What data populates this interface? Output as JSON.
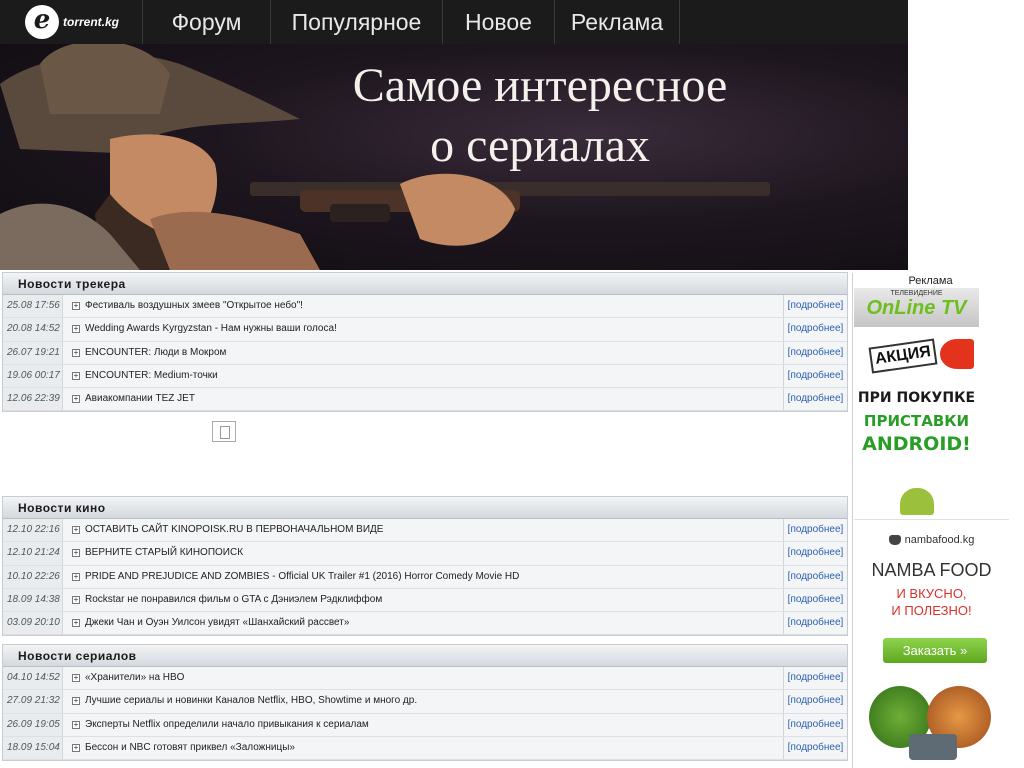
{
  "header": {
    "logo_text": "torrent.kg",
    "nav": [
      "Форум",
      "Популярное",
      "Новое",
      "Реклама"
    ]
  },
  "banner": {
    "line1": "Самое интересное",
    "line2": "о сериалах"
  },
  "sections": [
    {
      "title": "Новости трекера",
      "rows": [
        {
          "date": "25.08 17:56",
          "title": "Фестиваль воздушных змеев \"Открытое небо\"!",
          "more": "[подробнее]"
        },
        {
          "date": "20.08 14:52",
          "title": "Wedding Awards Kyrgyzstan - Нам нужны ваши голоса!",
          "more": "[подробнее]"
        },
        {
          "date": "26.07 19:21",
          "title": "ENCOUNTER: Люди в Мокром",
          "more": "[подробнее]"
        },
        {
          "date": "19.06 00:17",
          "title": "ENCOUNTER: Medium-точки",
          "more": "[подробнее]"
        },
        {
          "date": "12.06 22:39",
          "title": "Авиакомпании TEZ JET",
          "more": "[подробнее]"
        }
      ]
    },
    {
      "title": "Новости кино",
      "rows": [
        {
          "date": "12.10 22:16",
          "title": "ОСТАВИТЬ САЙТ KINOPOISK.RU В ПЕРВОНАЧАЛЬНОМ ВИДЕ",
          "more": "[подробнее]"
        },
        {
          "date": "12.10 21:24",
          "title": "ВЕРНИТЕ СТАРЫЙ КИНОПОИСК",
          "more": "[подробнее]"
        },
        {
          "date": "10.10 22:26",
          "title": "PRIDE AND PREJUDICE AND ZOMBIES - Official UK Trailer #1 (2016) Horror Comedy Movie HD",
          "more": "[подробнее]"
        },
        {
          "date": "18.09 14:38",
          "title": "Rockstar не понравился фильм о GTA с Дэниэлем Рэдклиффом",
          "more": "[подробнее]"
        },
        {
          "date": "03.09 20:10",
          "title": "Джеки Чан и Оуэн Уилсон увидят «Шанхайский рассвет»",
          "more": "[подробнее]"
        }
      ]
    },
    {
      "title": "Новости сериалов",
      "rows": [
        {
          "date": "04.10 14:52",
          "title": "«Хранители» на HBO",
          "more": "[подробнее]"
        },
        {
          "date": "27.09 21:32",
          "title": "Лучшие сериалы и новинки Каналов Netflix, HBO, Showtime и много др.",
          "more": "[подробнее]"
        },
        {
          "date": "26.09 19:05",
          "title": "Эксперты Netflix определили начало привыкания к сериалам",
          "more": "[подробнее]"
        },
        {
          "date": "18.09 15:04",
          "title": "Бессон и NBC готовят приквел «Заложницы»",
          "more": "[подробнее]"
        }
      ]
    }
  ],
  "sidebar": {
    "label": "Реклама",
    "ad1": {
      "tv": "ТЕЛЕВИДЕНИЕ",
      "brand": "OnLine TV",
      "badge": "АКЦИЯ",
      "line1": "ПРИ ПОКУПКЕ",
      "line2": "ПРИСТАВКИ",
      "line3": "ANDROID!"
    },
    "ad2": {
      "site": "nambafood.kg",
      "name": "NAMBA FOOD",
      "tag1": "И ВКУСНО,",
      "tag2": "И ПОЛЕЗНО!",
      "button": "Заказать  »"
    }
  }
}
